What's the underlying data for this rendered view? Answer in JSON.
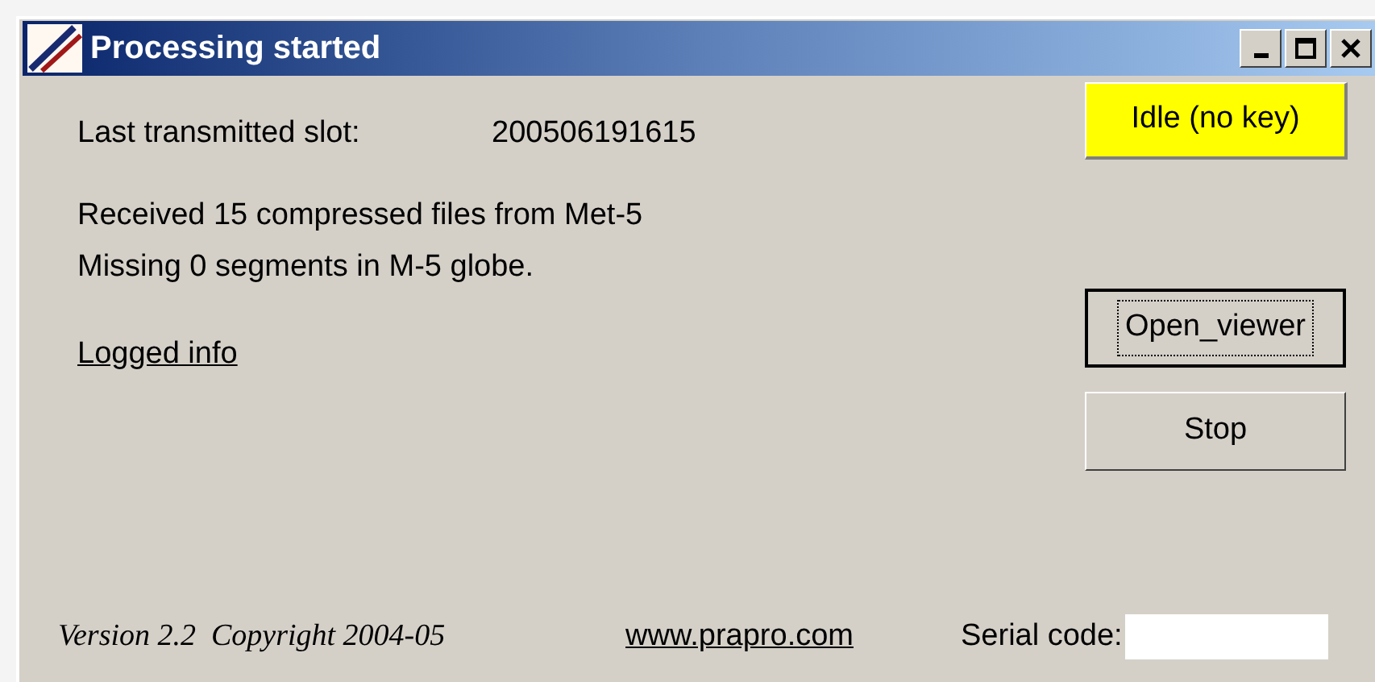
{
  "window": {
    "title": "Processing started"
  },
  "status": {
    "text": "Idle (no key)",
    "color": "#ffff00"
  },
  "slot": {
    "label": "Last transmitted slot:",
    "value": "200506191615"
  },
  "messages": [
    "Received 15 compressed files from Met-5",
    "Missing 0 segments in M-5 globe."
  ],
  "logged_info": "Logged info",
  "buttons": [
    {
      "label": "Open_viewer",
      "default": true
    },
    {
      "label": "Stop",
      "default": false
    }
  ],
  "footer": {
    "version": "Version 2.2  Copyright 2004-05",
    "link": "www.prapro.com",
    "serial_label": "Serial code:"
  }
}
